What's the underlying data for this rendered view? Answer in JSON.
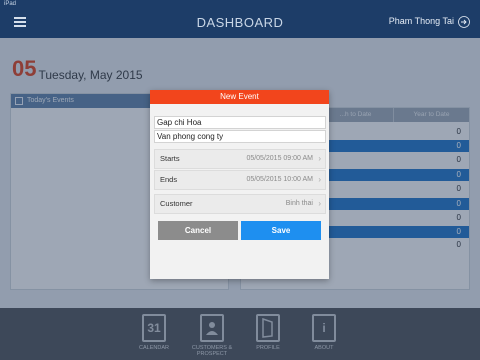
{
  "status_bar": {
    "carrier": "iPad",
    "time": "",
    "battery": ""
  },
  "navbar": {
    "title": "DASHBOARD",
    "user_name": "Pham Thong Tai"
  },
  "date_header": {
    "day": "05",
    "text": "Tuesday, May 2015"
  },
  "left_panel": {
    "header": "Today's Events"
  },
  "right_panel": {
    "tabs": [
      "",
      "...h to Date",
      "Year to Date"
    ],
    "values": [
      "0",
      "0",
      "0",
      "0",
      "0",
      "0",
      "0",
      "0",
      "0",
      "0"
    ]
  },
  "modal": {
    "title": "New Event",
    "title_field": "Gap chi Hoa",
    "location_field": "Van phong cong ty",
    "starts_label": "Starts",
    "starts_value": "05/05/2015 09:00 AM",
    "ends_label": "Ends",
    "ends_value": "05/05/2015 10:00 AM",
    "customer_label": "Customer",
    "customer_value": "Binh thai",
    "cancel_label": "Cancel",
    "save_label": "Save"
  },
  "tab_bar": {
    "items": [
      {
        "label": "CALENDAR",
        "icon": "calendar-icon",
        "glyph": "31"
      },
      {
        "label": "CUSTOMERS & PROSPECT",
        "icon": "address-book-icon",
        "glyph": ""
      },
      {
        "label": "PROFILE",
        "icon": "profile-icon",
        "glyph": ""
      },
      {
        "label": "ABOUT",
        "icon": "info-icon",
        "glyph": "i"
      }
    ]
  },
  "colors": {
    "navbar": "#1d3d68",
    "accent_red": "#d8411e",
    "modal_header": "#f2451c",
    "save_button": "#1e8ff0",
    "cancel_button": "#8c8c8c",
    "row_blue": "#1e73c4"
  }
}
